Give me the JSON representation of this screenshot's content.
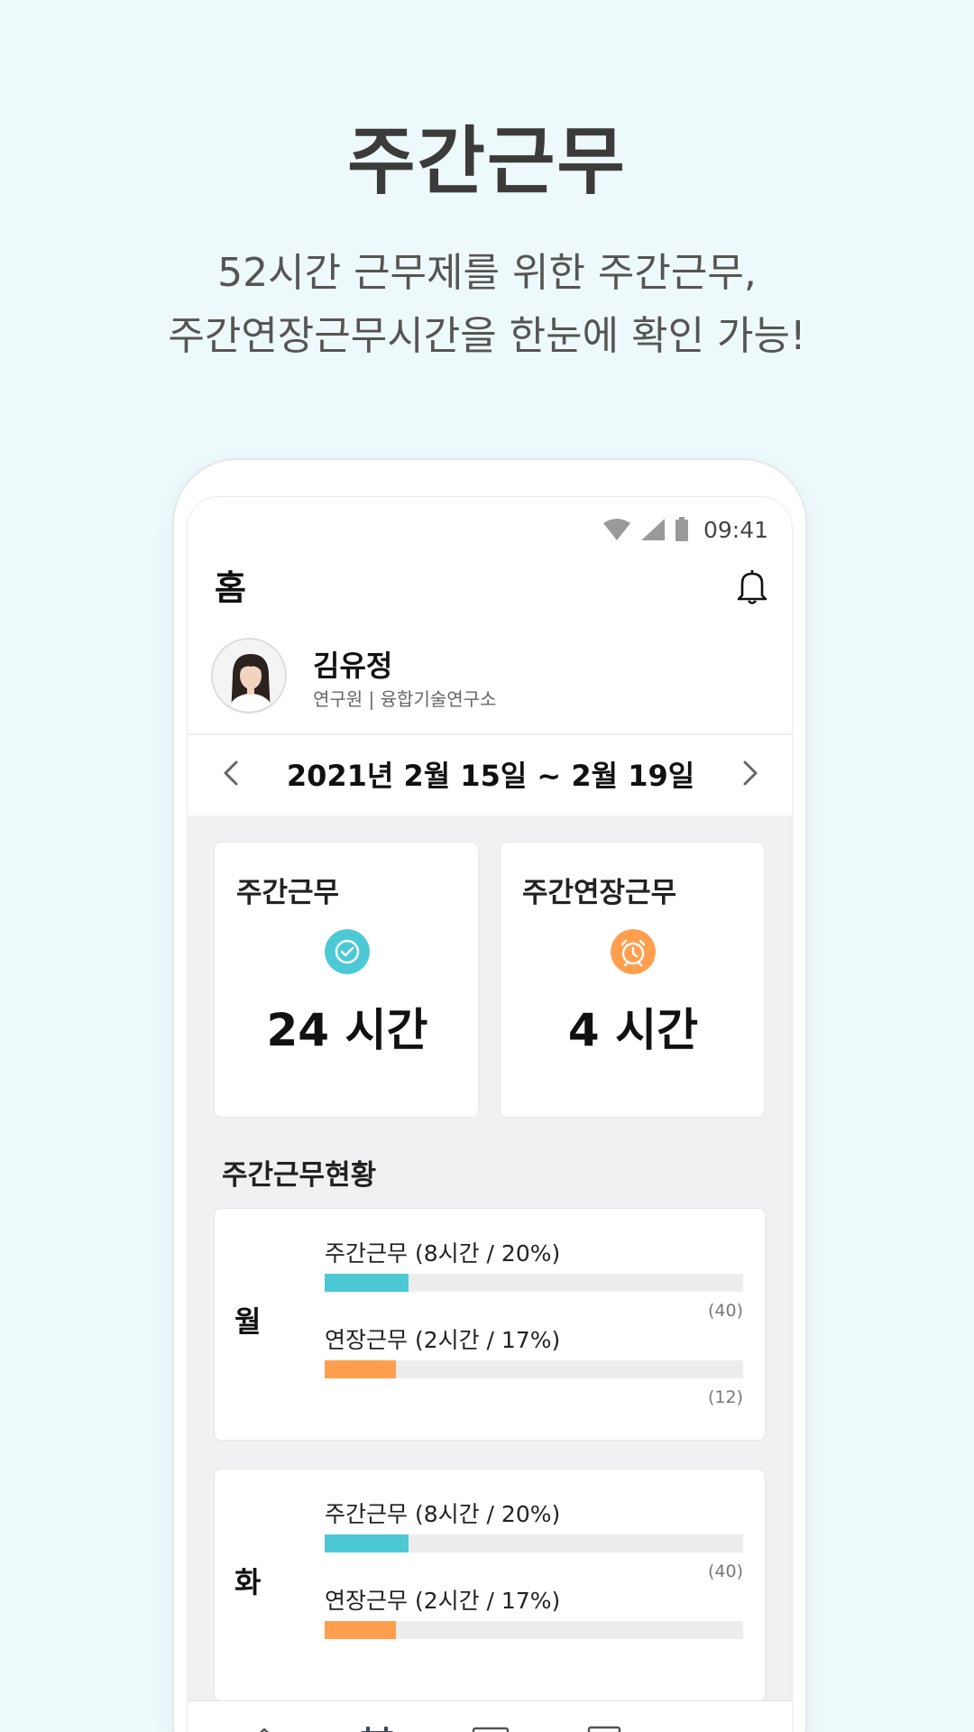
{
  "promo": {
    "title": "주간근무",
    "subtitle_line1": "52시간 근무제를 위한 주간근무,",
    "subtitle_line2": "주간연장근무시간을 한눈에 확인 가능!"
  },
  "status_bar": {
    "time": "09:41",
    "icons": [
      "wifi-icon",
      "signal-icon",
      "battery-icon"
    ]
  },
  "header": {
    "title": "홈",
    "bell_icon": "bell-icon"
  },
  "profile": {
    "name": "김유정",
    "role": "연구원 | 융합기술연구소"
  },
  "week": {
    "range": "2021년 2월 15일 ~ 2월 19일",
    "prev_icon": "chevron-left-icon",
    "next_icon": "chevron-right-icon"
  },
  "summary": {
    "weekly": {
      "label": "주간근무",
      "value": "24 시간",
      "icon": "check-circle-icon",
      "color": "#4dc9d5"
    },
    "overtime": {
      "label": "주간연장근무",
      "value": "4 시간",
      "icon": "alarm-clock-icon",
      "color": "#ff9e4f"
    }
  },
  "status_section": {
    "title": "주간근무현황"
  },
  "days": [
    {
      "day": "월",
      "work": {
        "label": "주간근무 (8시간 / 20%)",
        "percent": 20,
        "total": "(40)"
      },
      "overtime": {
        "label": "연장근무 (2시간 / 17%)",
        "percent": 17,
        "total": "(12)"
      }
    },
    {
      "day": "화",
      "work": {
        "label": "주간근무 (8시간 / 20%)",
        "percent": 20,
        "total": "(40)"
      },
      "overtime": {
        "label": "연장근무 (2시간 / 17%)",
        "percent": 17,
        "total": ""
      }
    }
  ],
  "tab_bar": {
    "tabs": [
      "home-icon",
      "calendar-icon",
      "list-icon",
      "profile-card-icon",
      "more-icon"
    ],
    "active": "calendar-icon"
  },
  "colors": {
    "background": "#eef9fc",
    "work": "#4dc9d5",
    "overtime": "#ff9e4f"
  }
}
